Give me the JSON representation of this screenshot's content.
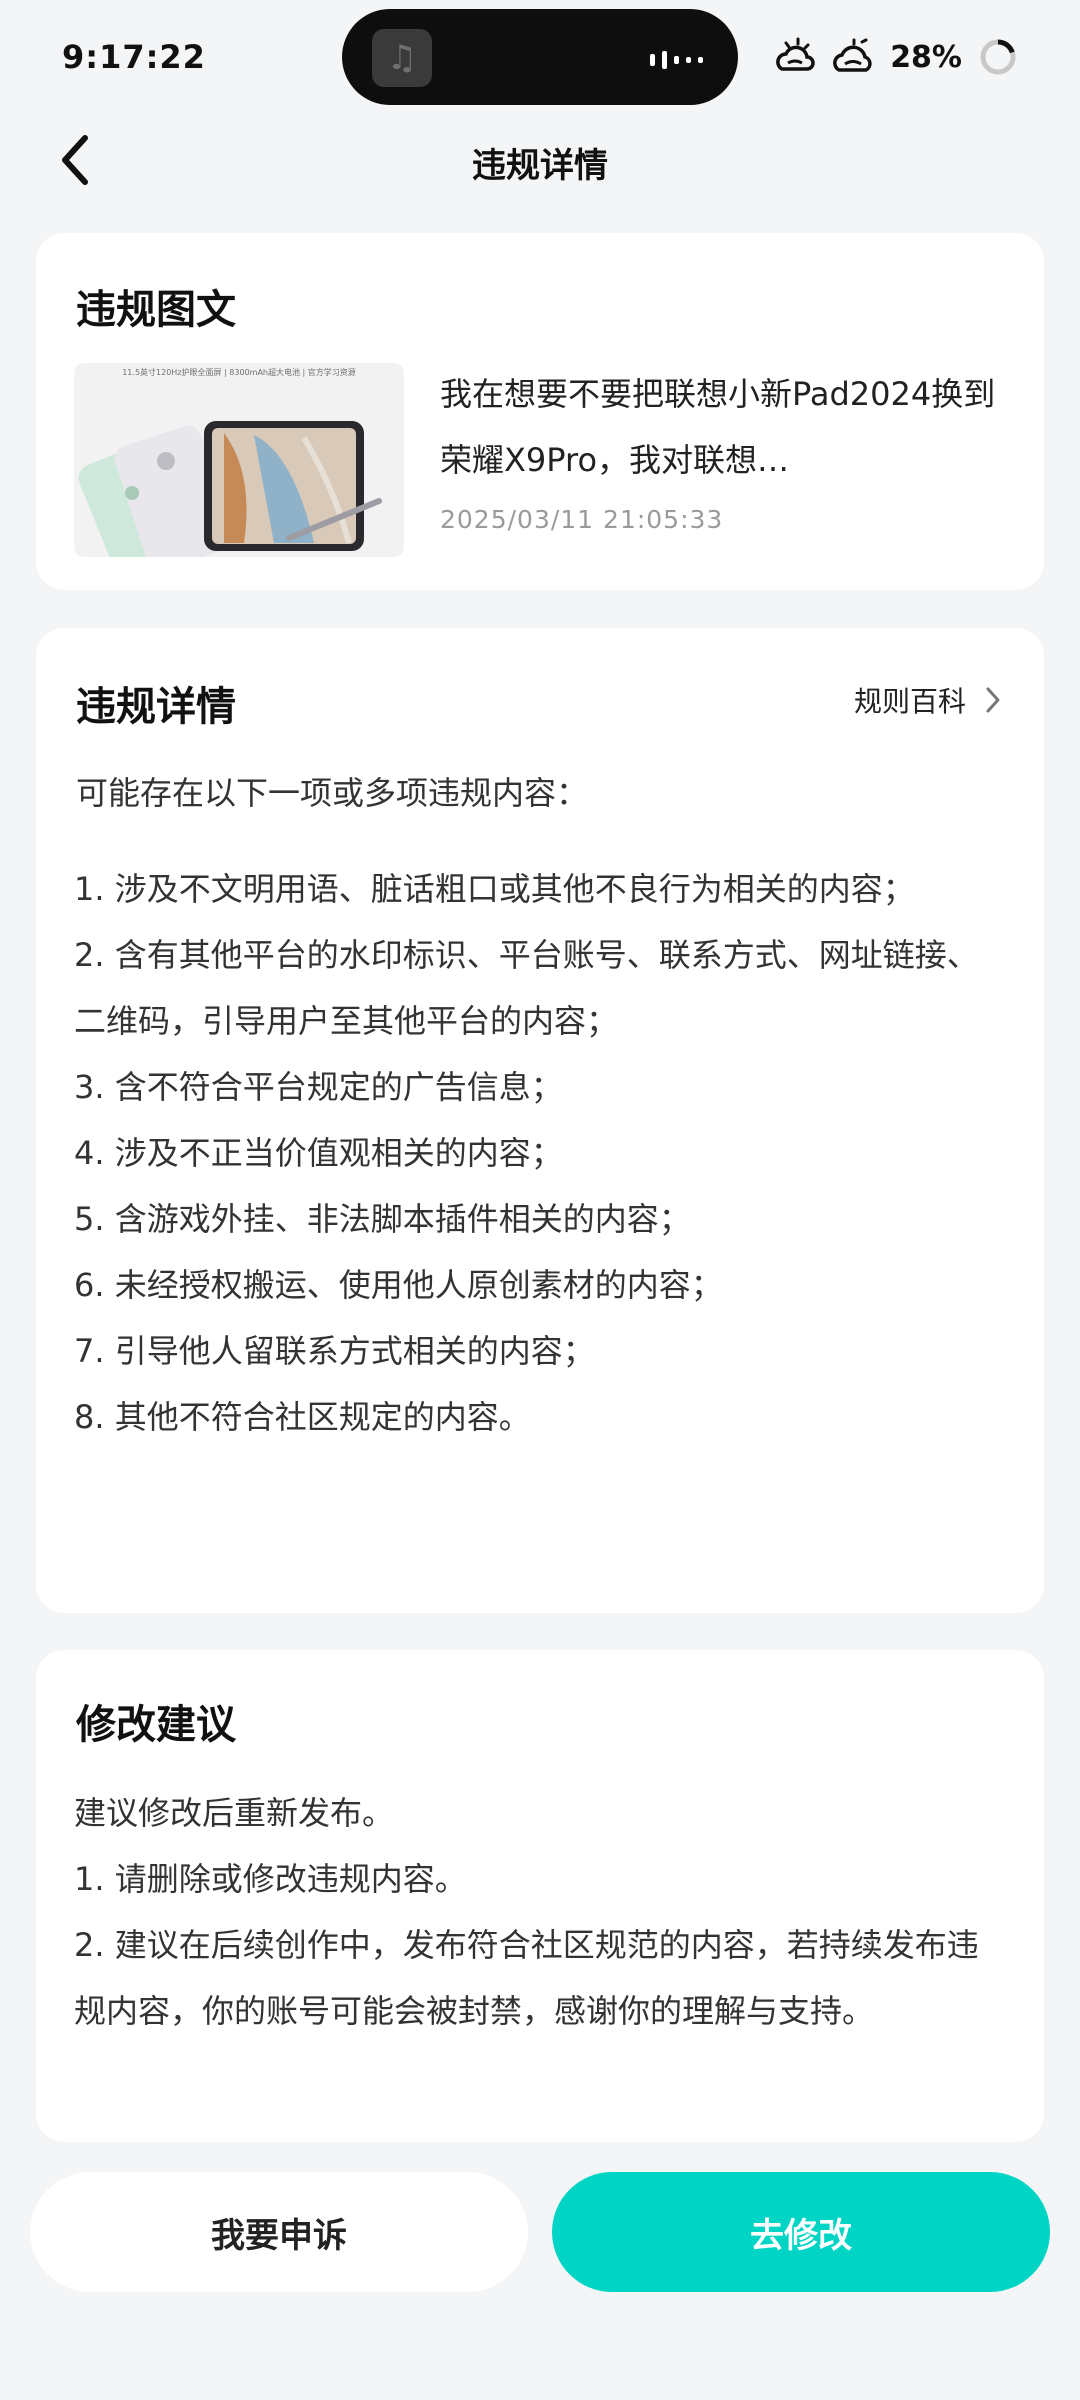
{
  "status_bar": {
    "time": "9:17:22",
    "battery": "28%"
  },
  "header": {
    "title": "违规详情",
    "back_icon": "chevron-left-icon"
  },
  "post_card": {
    "title": "违规图文",
    "thumbnail_caption": "11.5英寸120Hz护眼全面屏 | 8300mAh超大电池 | 官方学习资源",
    "text": "我在想要不要把联想小新Pad2024换到荣耀X9Pro，我对联想…",
    "date": "2025/03/11 21:05:33"
  },
  "detail_card": {
    "title": "违规详情",
    "link_label": "规则百科",
    "intro": "可能存在以下一项或多项违规内容：",
    "items": [
      "1. 涉及不文明用语、脏话粗口或其他不良行为相关的内容；",
      "2. 含有其他平台的水印标识、平台账号、联系方式、网址链接、二维码，引导用户至其他平台的内容；",
      "3. 含不符合平台规定的广告信息；",
      "4. 涉及不正当价值观相关的内容；",
      "5. 含游戏外挂、非法脚本插件相关的内容；",
      "6. 未经授权搬运、使用他人原创素材的内容；",
      "7. 引导他人留联系方式相关的内容；",
      "8. 其他不符合社区规定的内容。"
    ]
  },
  "suggest_card": {
    "title": "修改建议",
    "lines": [
      "建议修改后重新发布。",
      "1. 请删除或修改违规内容。",
      "2. 建议在后续创作中，发布符合社区规范的内容，若持续发布违规内容，你的账号可能会被封禁，感谢你的理解与支持。"
    ]
  },
  "actions": {
    "appeal_label": "我要申诉",
    "modify_label": "去修改"
  },
  "colors": {
    "accent": "#00d4c4",
    "background": "#f4f5f7"
  }
}
